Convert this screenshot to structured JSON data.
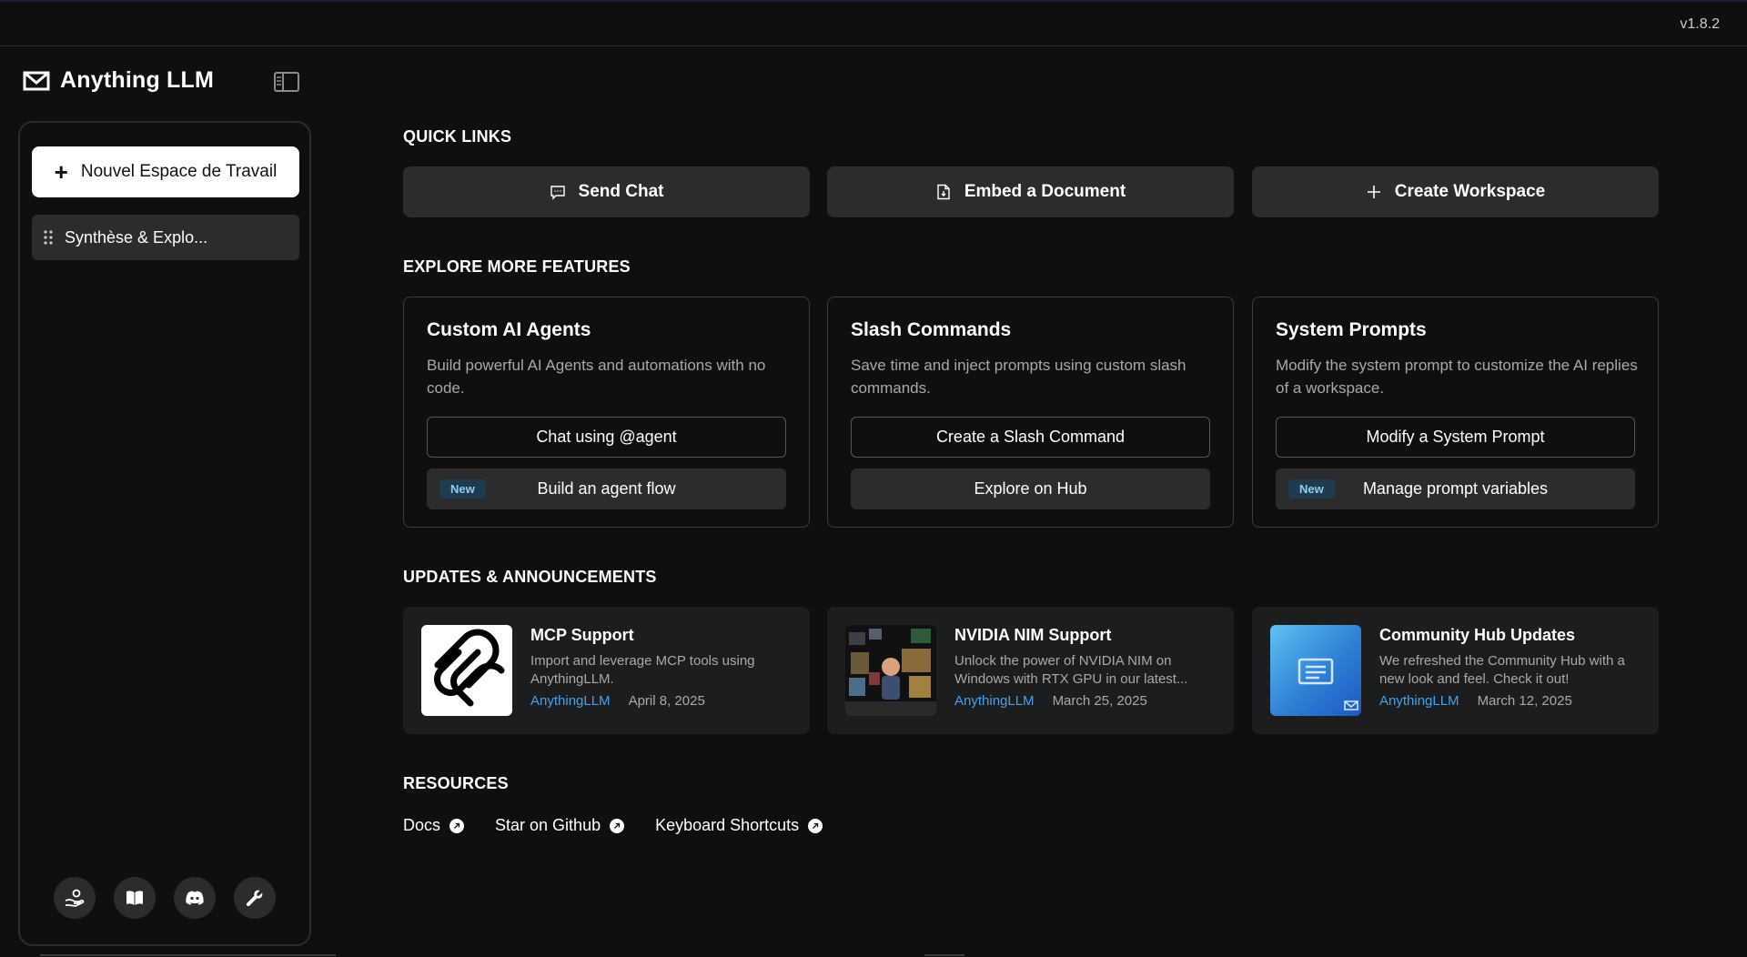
{
  "app": {
    "version": "v1.8.2",
    "brand": "Anything LLM"
  },
  "sidebar": {
    "new_workspace_label": "Nouvel Espace de Travail",
    "workspaces": [
      {
        "label": "Synthèse & Explo..."
      }
    ],
    "footer_icons": [
      "community-hub-icon",
      "docs-book-icon",
      "discord-icon",
      "settings-wrench-icon"
    ]
  },
  "quick_links": {
    "title": "QUICK LINKS",
    "items": [
      {
        "label": "Send Chat",
        "icon": "chat-icon"
      },
      {
        "label": "Embed a Document",
        "icon": "document-icon"
      },
      {
        "label": "Create Workspace",
        "icon": "plus-icon"
      }
    ]
  },
  "explore": {
    "title": "EXPLORE MORE FEATURES",
    "cards": [
      {
        "title": "Custom AI Agents",
        "description": "Build powerful AI Agents and automations with no code.",
        "primary_label": "Chat using @agent",
        "secondary_label": "Build an agent flow",
        "badge": "New"
      },
      {
        "title": "Slash Commands",
        "description": "Save time and inject prompts using custom slash commands.",
        "primary_label": "Create a Slash Command",
        "secondary_label": "Explore on Hub",
        "badge": ""
      },
      {
        "title": "System Prompts",
        "description": "Modify the system prompt to customize the AI replies of a workspace.",
        "primary_label": "Modify a System Prompt",
        "secondary_label": "Manage prompt variables",
        "badge": "New"
      }
    ]
  },
  "updates": {
    "title": "UPDATES & ANNOUNCEMENTS",
    "items": [
      {
        "title": "MCP Support",
        "description": "Import and leverage MCP tools using AnythingLLM.",
        "author": "AnythingLLM",
        "date": "April 8, 2025"
      },
      {
        "title": "NVIDIA NIM Support",
        "description": "Unlock the power of NVIDIA NIM on Windows with RTX GPU in our latest...",
        "author": "AnythingLLM",
        "date": "March 25, 2025"
      },
      {
        "title": "Community Hub Updates",
        "description": "We refreshed the Community Hub with a new look and feel. Check it out!",
        "author": "AnythingLLM",
        "date": "March 12, 2025"
      }
    ]
  },
  "resources": {
    "title": "RESOURCES",
    "links": [
      {
        "label": "Docs"
      },
      {
        "label": "Star on Github"
      },
      {
        "label": "Keyboard Shortcuts"
      }
    ]
  },
  "colors": {
    "background": "#0e0f0f",
    "card": "#2b2c2e",
    "accent_link": "#3fa3f0",
    "badge_bg": "#1f3b4d",
    "badge_text": "#8ad1f5"
  }
}
